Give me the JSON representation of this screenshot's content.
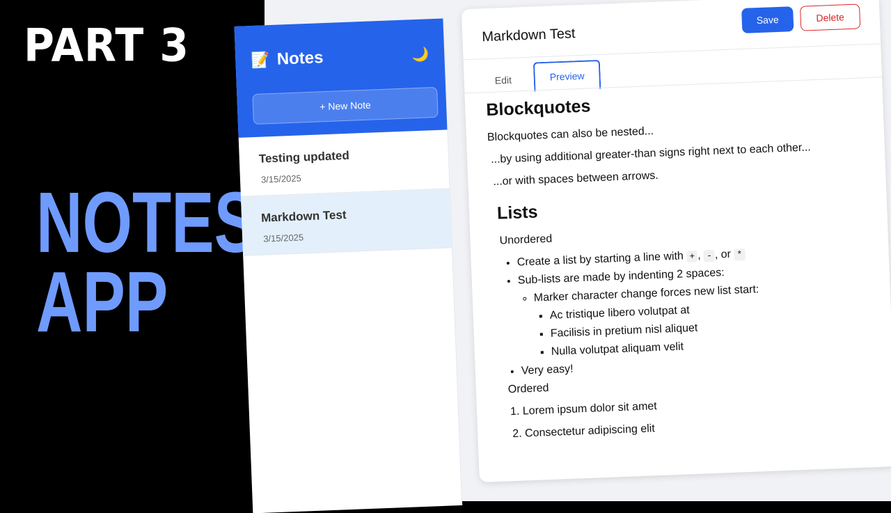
{
  "promo": {
    "part": "PART 3",
    "line1": "NOTES",
    "line2": "APP",
    "accent": "#6f9bff"
  },
  "sidebar": {
    "brand": "Notes",
    "brand_icon": "memo-icon",
    "theme_icon": "moon-icon",
    "new_note": "+ New Note",
    "notes": [
      {
        "title": "Testing updated",
        "date": "3/15/2025"
      },
      {
        "title": "Markdown Test",
        "date": "3/15/2025"
      }
    ]
  },
  "editor": {
    "title": "Markdown Test",
    "save": "Save",
    "delete": "Delete",
    "tabs": [
      "Edit",
      "Preview"
    ],
    "active_tab": "Preview"
  },
  "preview": {
    "h_blockquotes": "Blockquotes",
    "bq1": "Blockquotes can also be nested...",
    "bq2": "...by using additional greater-than signs right next to each other...",
    "bq3": "...or with spaces between arrows.",
    "h_lists": "Lists",
    "unordered": "Unordered",
    "li1_pre": "Create a list by starting a line with",
    "li1_code1": "+",
    "li1_code2": "-",
    "li1_code3": "*",
    "li1_sep": ",",
    "li1_or": ", or",
    "li2": "Sub-lists are made by indenting 2 spaces:",
    "li2_1": "Marker character change forces new list start:",
    "li2_1_a": "Ac tristique libero volutpat at",
    "li2_1_b": "Facilisis in pretium nisl aliquet",
    "li2_1_c": "Nulla volutpat aliquam velit",
    "li3": "Very easy!",
    "ordered": "Ordered",
    "ol1": "1. Lorem ipsum dolor sit amet",
    "ol2": "2. Consectetur adipiscing elit"
  },
  "colors": {
    "primary": "#2563eb",
    "danger": "#dc2626",
    "active_note_bg": "#e3f0fb"
  }
}
